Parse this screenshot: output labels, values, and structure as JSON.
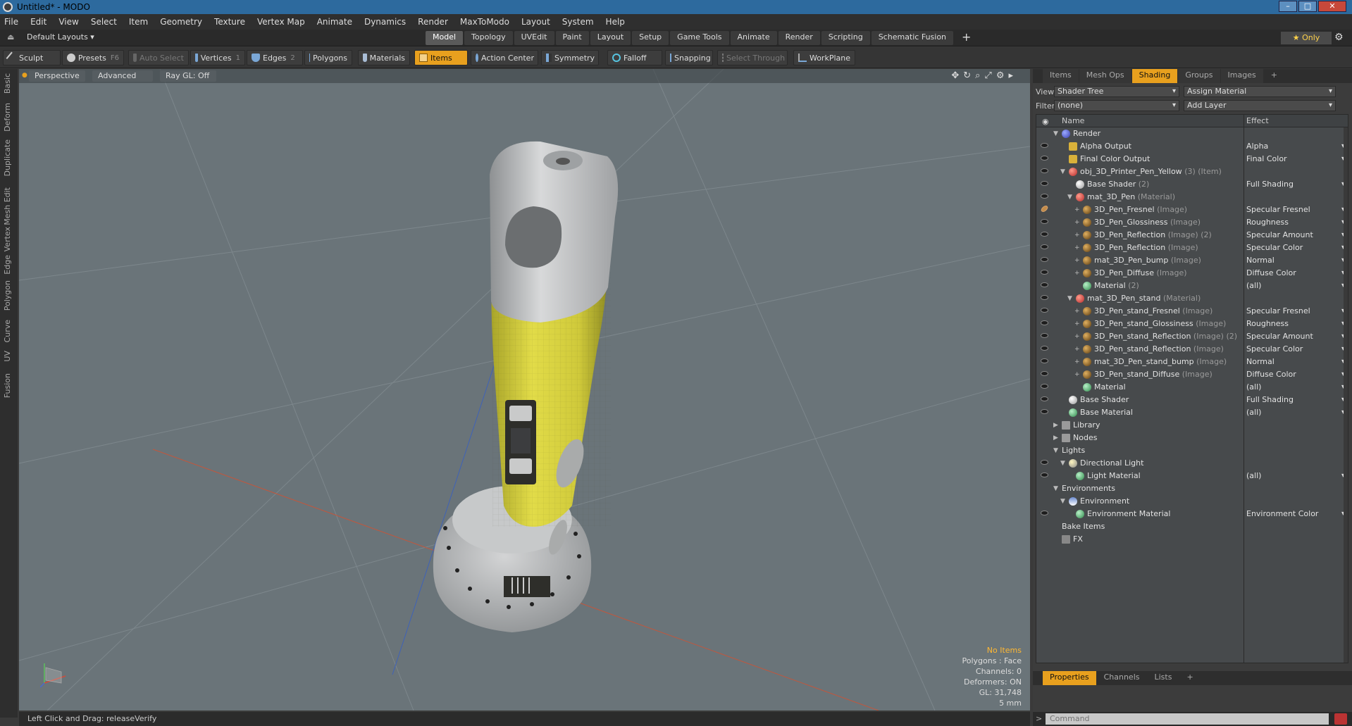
{
  "window": {
    "title": "Untitled* - MODO"
  },
  "menu": [
    "File",
    "Edit",
    "View",
    "Select",
    "Item",
    "Geometry",
    "Texture",
    "Vertex Map",
    "Animate",
    "Dynamics",
    "Render",
    "MaxToModo",
    "Layout",
    "System",
    "Help"
  ],
  "layouts": {
    "default": "Default Layouts ▾",
    "tabs": [
      "Model",
      "Topology",
      "UVEdit",
      "Paint",
      "Layout",
      "Setup",
      "Game Tools",
      "Animate",
      "Render",
      "Scripting",
      "Schematic Fusion"
    ],
    "active": "Model",
    "plus": "+",
    "only": "★ Only"
  },
  "toolbar": {
    "sculpt": "Sculpt",
    "presets": "Presets",
    "presets_key": "F6",
    "auto_select": "Auto Select",
    "vertices": "Vertices",
    "vertices_key": "1",
    "edges": "Edges",
    "edges_key": "2",
    "polygons": "Polygons",
    "materials": "Materials",
    "items": "Items",
    "action_center": "Action Center",
    "symmetry": "Symmetry",
    "falloff": "Falloff",
    "snapping": "Snapping",
    "select_through": "Select Through",
    "workplane": "WorkPlane"
  },
  "left_tabs": [
    "Basic",
    "Deform",
    "Duplicate",
    "Mesh Edit",
    "Vertex",
    "Edge",
    "Polygon",
    "Curve",
    "UV",
    "Fusion"
  ],
  "viewport": {
    "view": "Perspective",
    "advanced": "Advanced",
    "raygl": "Ray GL: Off",
    "info": {
      "no_items": "No Items",
      "polygons": "Polygons : Face",
      "channels": "Channels: 0",
      "deformers": "Deformers: ON",
      "gl": "GL: 31,748",
      "unit": "5 mm"
    }
  },
  "status": "Left Click and Drag:   releaseVerify",
  "panel": {
    "tabs": [
      "Items",
      "Mesh Ops",
      "Shading",
      "Groups",
      "Images"
    ],
    "active": "Shading",
    "plus": "+",
    "view_label": "View",
    "view_value": "Shader Tree",
    "assign": "Assign Material",
    "filter_label": "Filter",
    "filter_value": "(none)",
    "add_layer": "Add Layer",
    "col_name": "Name",
    "col_effect": "Effect",
    "tree": [
      {
        "d": 0,
        "tw": "▼",
        "eye": false,
        "icon": "render",
        "name": "Render",
        "sub": "",
        "effect": ""
      },
      {
        "d": 1,
        "tw": "",
        "eye": true,
        "icon": "output",
        "name": "Alpha Output",
        "sub": "",
        "effect": "Alpha"
      },
      {
        "d": 1,
        "tw": "",
        "eye": true,
        "icon": "output",
        "name": "Final Color Output",
        "sub": "",
        "effect": "Final Color"
      },
      {
        "d": 1,
        "tw": "▼",
        "eye": true,
        "icon": "mask",
        "name": "obj_3D_Printer_Pen_Yellow",
        "sub": "(3) (Item)",
        "effect": ""
      },
      {
        "d": 2,
        "tw": "",
        "eye": true,
        "icon": "shader",
        "name": "Base Shader",
        "sub": "(2)",
        "effect": "Full Shading"
      },
      {
        "d": 2,
        "tw": "▼",
        "eye": true,
        "icon": "mask",
        "name": "mat_3D_Pen",
        "sub": "(Material)",
        "effect": ""
      },
      {
        "d": 3,
        "tw": "+",
        "eye": "pen",
        "icon": "image",
        "name": "3D_Pen_Fresnel",
        "sub": "(Image)",
        "effect": "Specular Fresnel"
      },
      {
        "d": 3,
        "tw": "+",
        "eye": true,
        "icon": "image",
        "name": "3D_Pen_Glossiness",
        "sub": "(Image)",
        "effect": "Roughness"
      },
      {
        "d": 3,
        "tw": "+",
        "eye": true,
        "icon": "image",
        "name": "3D_Pen_Reflection",
        "sub": "(Image) (2)",
        "effect": "Specular Amount"
      },
      {
        "d": 3,
        "tw": "+",
        "eye": true,
        "icon": "image",
        "name": "3D_Pen_Reflection",
        "sub": "(Image)",
        "effect": "Specular Color"
      },
      {
        "d": 3,
        "tw": "+",
        "eye": true,
        "icon": "image",
        "name": "mat_3D_Pen_bump",
        "sub": "(Image)",
        "effect": "Normal"
      },
      {
        "d": 3,
        "tw": "+",
        "eye": true,
        "icon": "image",
        "name": "3D_Pen_Diffuse",
        "sub": "(Image)",
        "effect": "Diffuse Color"
      },
      {
        "d": 3,
        "tw": "",
        "eye": true,
        "icon": "material",
        "name": "Material",
        "sub": "(2)",
        "effect": "(all)"
      },
      {
        "d": 2,
        "tw": "▼",
        "eye": true,
        "icon": "mask",
        "name": "mat_3D_Pen_stand",
        "sub": "(Material)",
        "effect": ""
      },
      {
        "d": 3,
        "tw": "+",
        "eye": true,
        "icon": "image",
        "name": "3D_Pen_stand_Fresnel",
        "sub": "(Image)",
        "effect": "Specular Fresnel"
      },
      {
        "d": 3,
        "tw": "+",
        "eye": true,
        "icon": "image",
        "name": "3D_Pen_stand_Glossiness",
        "sub": "(Image)",
        "effect": "Roughness"
      },
      {
        "d": 3,
        "tw": "+",
        "eye": true,
        "icon": "image",
        "name": "3D_Pen_stand_Reflection",
        "sub": "(Image) (2)",
        "effect": "Specular Amount"
      },
      {
        "d": 3,
        "tw": "+",
        "eye": true,
        "icon": "image",
        "name": "3D_Pen_stand_Reflection",
        "sub": "(Image)",
        "effect": "Specular Color"
      },
      {
        "d": 3,
        "tw": "+",
        "eye": true,
        "icon": "image",
        "name": "mat_3D_Pen_stand_bump",
        "sub": "(Image)",
        "effect": "Normal"
      },
      {
        "d": 3,
        "tw": "+",
        "eye": true,
        "icon": "image",
        "name": "3D_Pen_stand_Diffuse",
        "sub": "(Image)",
        "effect": "Diffuse Color"
      },
      {
        "d": 3,
        "tw": "",
        "eye": true,
        "icon": "material",
        "name": "Material",
        "sub": "",
        "effect": "(all)"
      },
      {
        "d": 1,
        "tw": "",
        "eye": true,
        "icon": "shader",
        "name": "Base Shader",
        "sub": "",
        "effect": "Full Shading"
      },
      {
        "d": 1,
        "tw": "",
        "eye": true,
        "icon": "material",
        "name": "Base Material",
        "sub": "",
        "effect": "(all)"
      },
      {
        "d": 0,
        "tw": "▶",
        "eye": false,
        "icon": "folder",
        "name": "Library",
        "sub": "",
        "effect": ""
      },
      {
        "d": 0,
        "tw": "▶",
        "eye": false,
        "icon": "folder",
        "name": "Nodes",
        "sub": "",
        "effect": ""
      },
      {
        "d": 0,
        "tw": "▼",
        "eye": false,
        "icon": "none",
        "name": "Lights",
        "sub": "",
        "effect": ""
      },
      {
        "d": 1,
        "tw": "▼",
        "eye": true,
        "icon": "light",
        "name": "Directional Light",
        "sub": "",
        "effect": ""
      },
      {
        "d": 2,
        "tw": "",
        "eye": true,
        "icon": "material",
        "name": "Light Material",
        "sub": "",
        "effect": "(all)"
      },
      {
        "d": 0,
        "tw": "▼",
        "eye": false,
        "icon": "none",
        "name": "Environments",
        "sub": "",
        "effect": ""
      },
      {
        "d": 1,
        "tw": "▼",
        "eye": false,
        "icon": "env",
        "name": "Environment",
        "sub": "",
        "effect": ""
      },
      {
        "d": 2,
        "tw": "",
        "eye": true,
        "icon": "material",
        "name": "Environment Material",
        "sub": "",
        "effect": "Environment Color"
      },
      {
        "d": 0,
        "tw": "",
        "eye": false,
        "icon": "none",
        "name": "Bake Items",
        "sub": "",
        "effect": ""
      },
      {
        "d": 0,
        "tw": "",
        "eye": false,
        "icon": "fx",
        "name": "FX",
        "sub": "",
        "effect": ""
      }
    ],
    "bottom_tabs": [
      "Properties",
      "Channels",
      "Lists"
    ],
    "bottom_active": "Properties",
    "bottom_plus": "+",
    "command_placeholder": "Command"
  },
  "colors": {
    "accent": "#e8a01e",
    "pen_yellow": "#d7d33a",
    "viewport_bg": "#6a7479"
  }
}
